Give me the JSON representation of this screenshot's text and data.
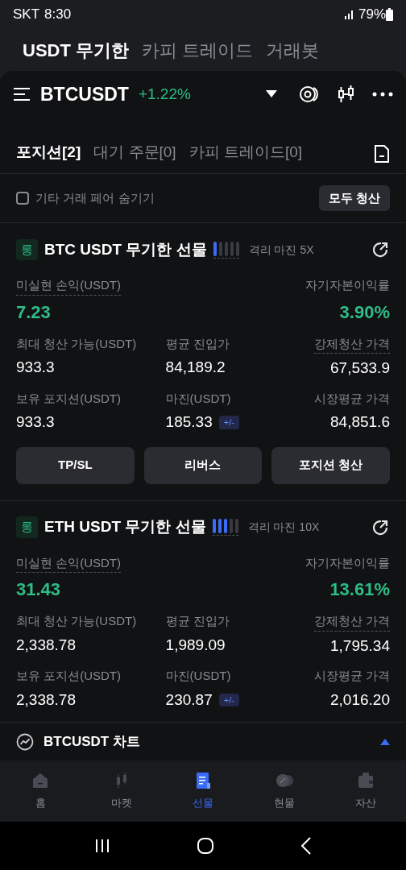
{
  "status_bar": {
    "carrier": "SKT",
    "time": "8:30",
    "battery": "79%"
  },
  "top_tabs": [
    {
      "label": "USDT 무기한",
      "selected": true
    },
    {
      "label": "카피 트레이드",
      "selected": false
    },
    {
      "label": "거래봇",
      "selected": false
    }
  ],
  "ticker": {
    "symbol": "BTCUSDT",
    "change": "+1.22%"
  },
  "position_tabs": [
    {
      "label": "포지션[2]",
      "selected": true
    },
    {
      "label": "대기 주문[0]",
      "selected": false
    },
    {
      "label": "카피 트레이드[0]",
      "selected": false
    }
  ],
  "filter": {
    "label": "기타 거래 페어 숨기기",
    "checked": false,
    "close_all": "모두 청산"
  },
  "positions": [
    {
      "side": "롱",
      "title": "BTC USDT 무기한 선물",
      "level": 0.2,
      "margin_mode": "격리 마진 5X",
      "pnl": {
        "label": "미실현 손익(USDT)",
        "value": "7.23"
      },
      "roe": {
        "label": "자기자본이익률",
        "value": "3.90%"
      },
      "fields": [
        {
          "label": "최대 청산 가능(USDT)",
          "value": "933.3",
          "underlined": false
        },
        {
          "label": "평균 진입가",
          "value": "84,189.2",
          "underlined": false
        },
        {
          "label": "강제청산 가격",
          "value": "67,533.9",
          "underlined": true
        },
        {
          "label": "보유 포지션(USDT)",
          "value": "933.3",
          "underlined": false
        },
        {
          "label": "마진(USDT)",
          "value": "185.33",
          "badge": "+/-",
          "underlined": false
        },
        {
          "label": "시장평균 가격",
          "value": "84,851.6",
          "underlined": false
        }
      ],
      "buttons": [
        "TP/SL",
        "리버스",
        "포지션 청산"
      ]
    },
    {
      "side": "롱",
      "title": "ETH USDT 무기한 선물",
      "level": 0.6,
      "margin_mode": "격리 마진 10X",
      "pnl": {
        "label": "미실현 손익(USDT)",
        "value": "31.43"
      },
      "roe": {
        "label": "자기자본이익률",
        "value": "13.61%"
      },
      "fields": [
        {
          "label": "최대 청산 가능(USDT)",
          "value": "2,338.78",
          "underlined": false
        },
        {
          "label": "평균 진입가",
          "value": "1,989.09",
          "underlined": false
        },
        {
          "label": "강제청산 가격",
          "value": "1,795.34",
          "underlined": true
        },
        {
          "label": "보유 포지션(USDT)",
          "value": "2,338.78",
          "underlined": false
        },
        {
          "label": "마진(USDT)",
          "value": "230.87",
          "badge": "+/-",
          "underlined": false
        },
        {
          "label": "시장평균 가격",
          "value": "2,016.20",
          "underlined": false
        }
      ]
    }
  ],
  "chart_bar": {
    "label": "BTCUSDT 차트",
    "expanded": false
  },
  "bottom_nav": [
    {
      "label": "홈",
      "selected": false
    },
    {
      "label": "마켓",
      "selected": false
    },
    {
      "label": "선물",
      "selected": true
    },
    {
      "label": "현물",
      "selected": false
    },
    {
      "label": "자산",
      "selected": false
    }
  ]
}
